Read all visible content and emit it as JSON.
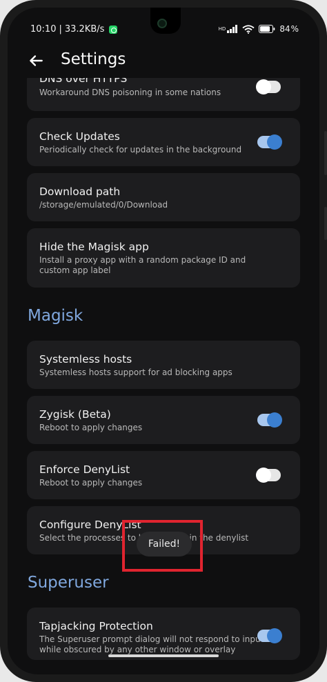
{
  "status": {
    "time": "10:10",
    "speed": "33.2KB/s",
    "hd": "HD",
    "battery": "84"
  },
  "header": {
    "title": "Settings"
  },
  "items": {
    "dns": {
      "title": "DNS over HTTPS",
      "sub": "Workaround DNS poisoning in some nations",
      "on": false
    },
    "updates": {
      "title": "Check Updates",
      "sub": "Periodically check for updates in the background",
      "on": true
    },
    "download": {
      "title": "Download path",
      "sub": "/storage/emulated/0/Download"
    },
    "hide": {
      "title": "Hide the Magisk app",
      "sub": "Install a proxy app with a random package ID and custom app label"
    },
    "hosts": {
      "title": "Systemless hosts",
      "sub": "Systemless hosts support for ad blocking apps"
    },
    "zygisk": {
      "title": "Zygisk (Beta)",
      "sub": "Reboot to apply changes",
      "on": true
    },
    "deny": {
      "title": "Enforce DenyList",
      "sub": "Reboot to apply changes",
      "on": false
    },
    "configure": {
      "title": "Configure DenyList",
      "sub": "Select the processes to be included in the denylist"
    },
    "tapjack": {
      "title": "Tapjacking Protection",
      "sub": "The Superuser prompt dialog will not respond to input while obscured by any other window or overlay",
      "on": true
    }
  },
  "sections": {
    "magisk": "Magisk",
    "superuser": "Superuser"
  },
  "toast": {
    "text": "Failed!"
  },
  "colors": {
    "accent": "#80a8df",
    "toggle_on": "#3b7fd0",
    "highlight": "#e0242f"
  }
}
